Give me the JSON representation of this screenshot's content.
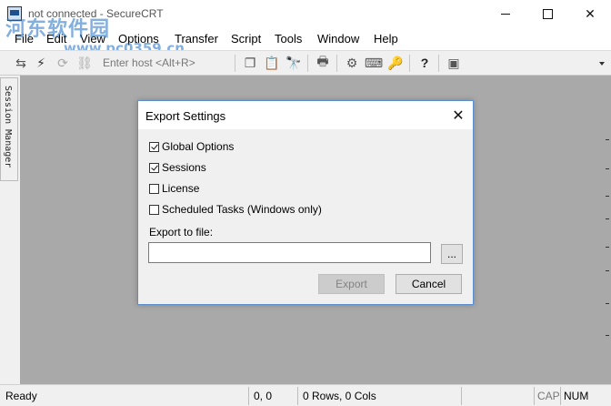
{
  "window": {
    "title": "not connected - SecureCRT",
    "watermark_cn": "河东软件园",
    "watermark_url": "www.pc0359.cn"
  },
  "menu": [
    {
      "label": "File"
    },
    {
      "label": "Edit"
    },
    {
      "label": "View"
    },
    {
      "label": "Options"
    },
    {
      "label": "Transfer"
    },
    {
      "label": "Script"
    },
    {
      "label": "Tools"
    },
    {
      "label": "Window"
    },
    {
      "label": "Help"
    }
  ],
  "toolbar": {
    "host_placeholder": "Enter host <Alt+R>"
  },
  "session_manager": {
    "label": "Session Manager"
  },
  "dialog": {
    "title": "Export Settings",
    "options": [
      {
        "label": "Global Options",
        "checked": true
      },
      {
        "label": "Sessions",
        "checked": true
      },
      {
        "label": "License",
        "checked": false
      },
      {
        "label": "Scheduled Tasks (Windows only)",
        "checked": false
      }
    ],
    "export_label": "Export to file:",
    "export_value": "",
    "browse_label": "...",
    "export_button": "Export",
    "cancel_button": "Cancel"
  },
  "status": {
    "ready": "Ready",
    "position": "0, 0",
    "dimensions": "0 Rows, 0 Cols",
    "cap": "CAP",
    "num": "NUM"
  },
  "colors": {
    "workspace": "#a9a9a9",
    "dialog_border": "#5b8fce",
    "watermark": "#1e6fc4"
  }
}
